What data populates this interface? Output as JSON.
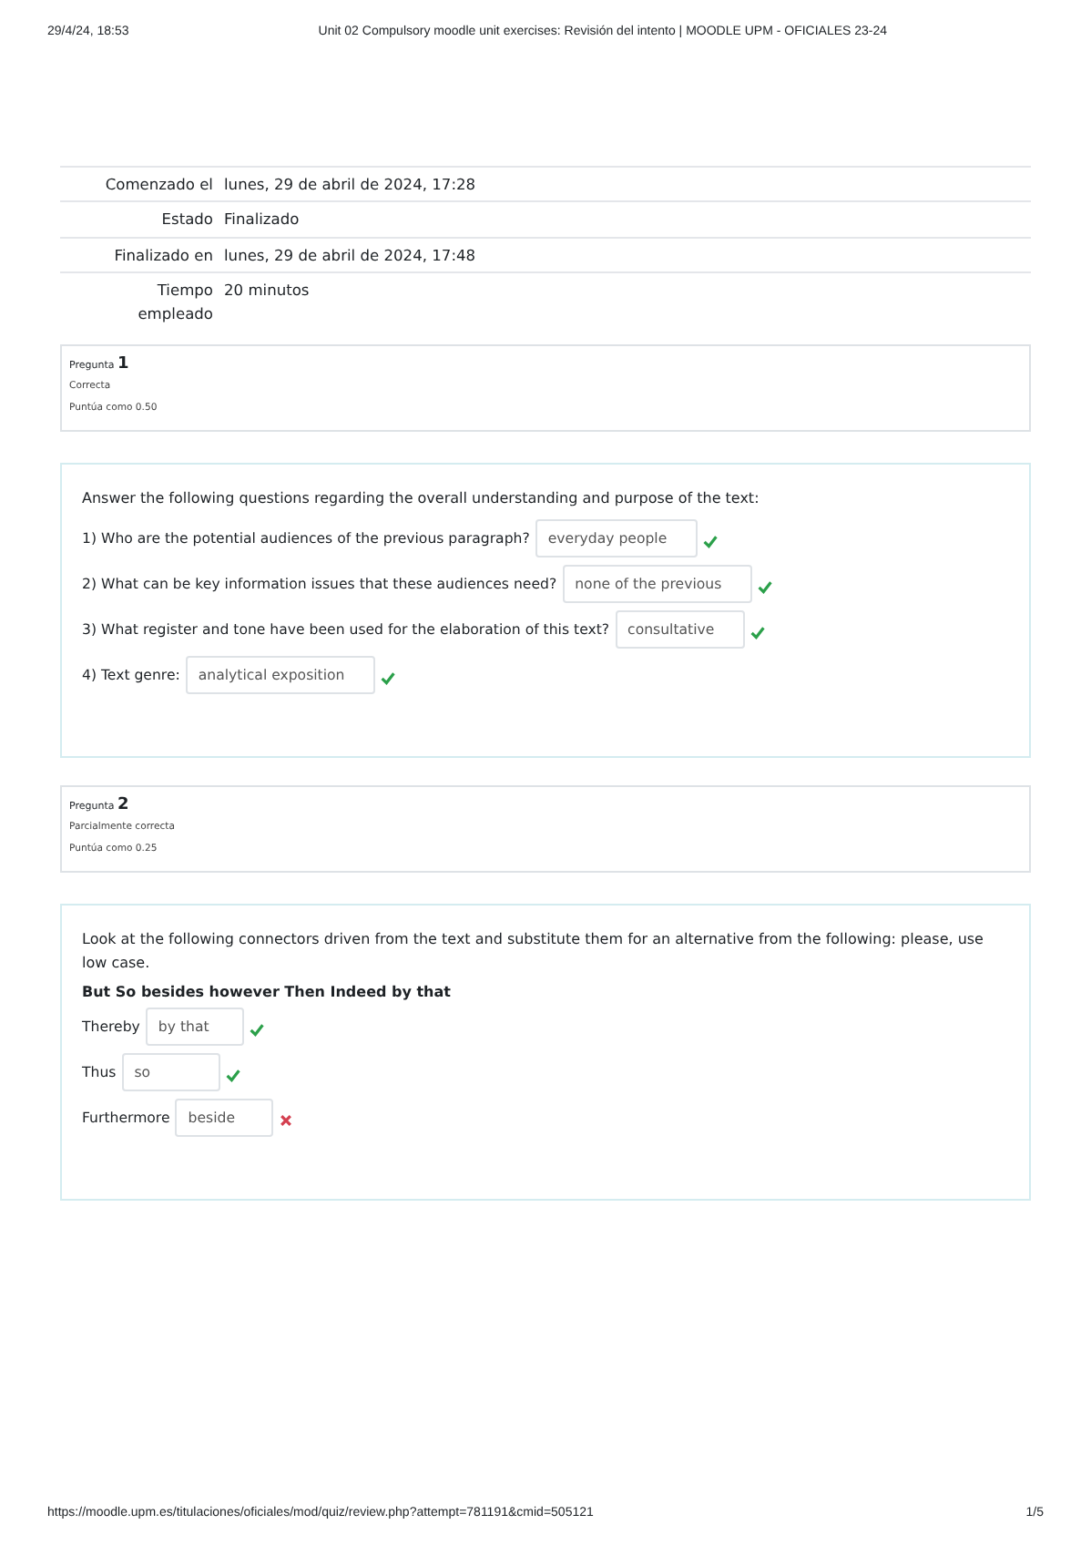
{
  "print_header": {
    "date": "29/4/24, 18:53",
    "title": "Unit 02 Compulsory moodle unit exercises: Revisión del intento | MOODLE UPM - OFICIALES 23-24"
  },
  "summary": [
    {
      "label": "Comenzado el",
      "value": "lunes, 29 de abril de 2024, 17:28"
    },
    {
      "label": "Estado",
      "value": "Finalizado"
    },
    {
      "label": "Finalizado en",
      "value": "lunes, 29 de abril de 2024, 17:48"
    },
    {
      "label": "Tiempo empleado",
      "value": "20 minutos"
    }
  ],
  "questions": [
    {
      "info": {
        "label": "Pregunta",
        "number": "1",
        "status": "Correcta",
        "score": "Puntúa como 0.50"
      },
      "intro": "Answer the following questions regarding the overall understanding and purpose of the text:",
      "items": [
        {
          "prompt": "1) Who are the potential audiences of the previous paragraph?",
          "answer": "everyday people",
          "correct": true
        },
        {
          "prompt": "2) What can be key information issues that these audiences need?",
          "answer": "none of the previous",
          "correct": true
        },
        {
          "prompt": "3) What register and tone have been used for the elaboration of this text?",
          "answer": "consultative",
          "correct": true
        },
        {
          "prompt": "4) Text genre:",
          "answer": "analytical exposition",
          "correct": true
        }
      ]
    },
    {
      "info": {
        "label": "Pregunta",
        "number": "2",
        "status": "Parcialmente correcta",
        "score": "Puntúa como 0.25"
      },
      "intro": "Look at the following connectors driven from the text and substitute them for an alternative from the following: please, use low case.",
      "keywords": "But So besides however Then Indeed by that",
      "items": [
        {
          "prompt": "Thereby",
          "answer": "by that",
          "correct": true
        },
        {
          "prompt": "Thus",
          "answer": "so",
          "correct": true
        },
        {
          "prompt": "Furthermore",
          "answer": "beside",
          "correct": false
        }
      ]
    }
  ],
  "print_footer": {
    "url": "https://moodle.upm.es/titulaciones/oficiales/mod/quiz/review.php?attempt=781191&cmid=505121",
    "page": "1/5"
  }
}
